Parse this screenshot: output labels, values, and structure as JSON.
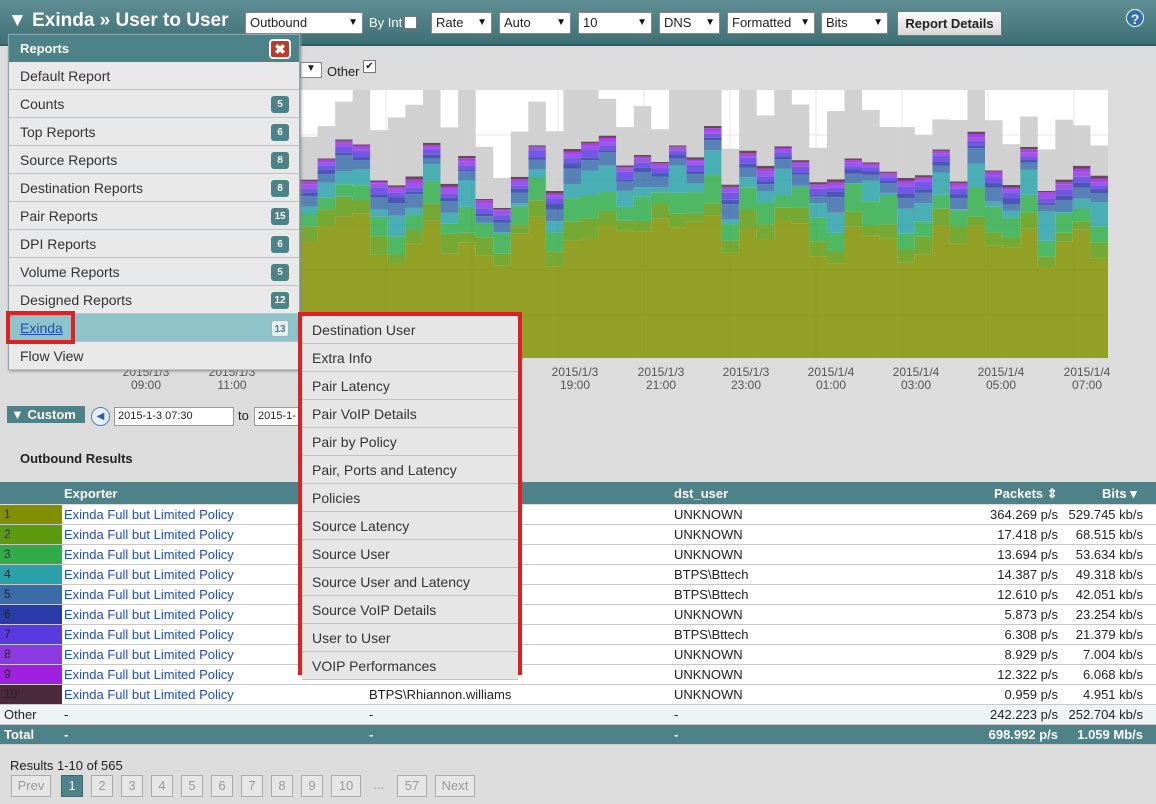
{
  "header": {
    "title": "▼ Exinda » User to User",
    "direction": "Outbound",
    "by_int_label": "By Int",
    "rate": "Rate",
    "auto": "Auto",
    "count": "10",
    "dns": "DNS",
    "formatted": "Formatted",
    "bits": "Bits",
    "report_details": "Report Details",
    "help": "?"
  },
  "graph_controls": {
    "other_label": "Other"
  },
  "chart_data": {
    "type": "area",
    "stacked": true,
    "x_ticks": [
      "2015/1/3 09:00",
      "2015/1/3 11:00",
      "2015/1/3 19:00",
      "2015/1/3 21:00",
      "2015/1/3 23:00",
      "2015/1/4 01:00",
      "2015/1/4 03:00",
      "2015/1/4 05:00",
      "2015/1/4 07:00"
    ],
    "series_colors": [
      "#7f8f00",
      "#5e9a10",
      "#2fab4a",
      "#2aa0a8",
      "#3a6ca8",
      "#2a3aa8",
      "#5a3ae0",
      "#8a3ae0",
      "#a020e0",
      "#4a2a3a",
      "#cccccc"
    ],
    "grid": true
  },
  "custom": {
    "label": "▼ Custom",
    "from": "2015-1-3 07:30",
    "to_label": "to",
    "to": "2015-1-"
  },
  "results_title": "Outbound Results",
  "table": {
    "headers": {
      "exporter": "Exporter",
      "dst_user": "dst_user",
      "packets": "Packets",
      "bits": "Bits"
    },
    "rows": [
      {
        "n": "1",
        "exporter": "Exinda Full but Limited Policy",
        "src": "",
        "dst": "UNKNOWN",
        "packets": "364.269 p/s",
        "bits": "529.745 kb/s",
        "color": "#7f8f00"
      },
      {
        "n": "2",
        "exporter": "Exinda Full but Limited Policy",
        "src": "",
        "dst": "UNKNOWN",
        "packets": "17.418 p/s",
        "bits": "68.515 kb/s",
        "color": "#5e9a10"
      },
      {
        "n": "3",
        "exporter": "Exinda Full but Limited Policy",
        "src": "",
        "dst": "UNKNOWN",
        "packets": "13.694 p/s",
        "bits": "53.634 kb/s",
        "color": "#2fab4a"
      },
      {
        "n": "4",
        "exporter": "Exinda Full but Limited Policy",
        "src": "",
        "dst": "BTPS\\Bttech",
        "packets": "14.387 p/s",
        "bits": "49.318 kb/s",
        "color": "#2aa0a8"
      },
      {
        "n": "5",
        "exporter": "Exinda Full but Limited Policy",
        "src": "",
        "dst": "BTPS\\Bttech",
        "packets": "12.610 p/s",
        "bits": "42.051 kb/s",
        "color": "#3a6ca8"
      },
      {
        "n": "6",
        "exporter": "Exinda Full but Limited Policy",
        "src": "",
        "dst": "UNKNOWN",
        "packets": "5.873 p/s",
        "bits": "23.254 kb/s",
        "color": "#2a3aa8"
      },
      {
        "n": "7",
        "exporter": "Exinda Full but Limited Policy",
        "src": "",
        "dst": "BTPS\\Bttech",
        "packets": "6.308 p/s",
        "bits": "21.379 kb/s",
        "color": "#5a3ae0"
      },
      {
        "n": "8",
        "exporter": "Exinda Full but Limited Policy",
        "src": "",
        "dst": "UNKNOWN",
        "packets": "8.929 p/s",
        "bits": "7.004 kb/s",
        "color": "#8a3ae0"
      },
      {
        "n": "9",
        "exporter": "Exinda Full but Limited Policy",
        "src": "",
        "dst": "UNKNOWN",
        "packets": "12.322 p/s",
        "bits": "6.068 kb/s",
        "color": "#a020e0"
      },
      {
        "n": "10",
        "exporter": "Exinda Full but Limited Policy",
        "src": "BTPS\\Rhiannon.williams",
        "dst": "UNKNOWN",
        "packets": "0.959 p/s",
        "bits": "4.951 kb/s",
        "color": "#4a2a3a"
      }
    ],
    "other": {
      "label": "Other",
      "exporter": "-",
      "src": "-",
      "dst": "-",
      "packets": "242.223 p/s",
      "bits": "252.704 kb/s"
    },
    "total": {
      "label": "Total",
      "exporter": "-",
      "src": "-",
      "dst": "-",
      "packets": "698.992 p/s",
      "bits": "1.059 Mb/s"
    }
  },
  "results_text": "Results 1-10 of 565",
  "pagination": [
    "Prev",
    "1",
    "2",
    "3",
    "4",
    "5",
    "6",
    "7",
    "8",
    "9",
    "10",
    "...",
    "57",
    "Next"
  ],
  "reports_panel": {
    "title": "Reports",
    "items": [
      {
        "label": "Default Report",
        "badge": ""
      },
      {
        "label": "Counts",
        "badge": "5"
      },
      {
        "label": "Top Reports",
        "badge": "6"
      },
      {
        "label": "Source Reports",
        "badge": "8"
      },
      {
        "label": "Destination Reports",
        "badge": "8"
      },
      {
        "label": "Pair Reports",
        "badge": "15"
      },
      {
        "label": "DPI Reports",
        "badge": "6"
      },
      {
        "label": "Volume Reports",
        "badge": "5"
      },
      {
        "label": "Designed Reports",
        "badge": "12"
      },
      {
        "label": "Exinda",
        "badge": "13"
      },
      {
        "label": "Flow View",
        "badge": ""
      }
    ]
  },
  "submenu": [
    "Destination User",
    "Extra Info",
    "Pair Latency",
    "Pair VoIP Details",
    "Pair by Policy",
    "Pair, Ports and Latency",
    "Policies",
    "Source Latency",
    "Source User",
    "Source User and Latency",
    "Source VoIP Details",
    "User to User",
    "VOIP Performances"
  ]
}
